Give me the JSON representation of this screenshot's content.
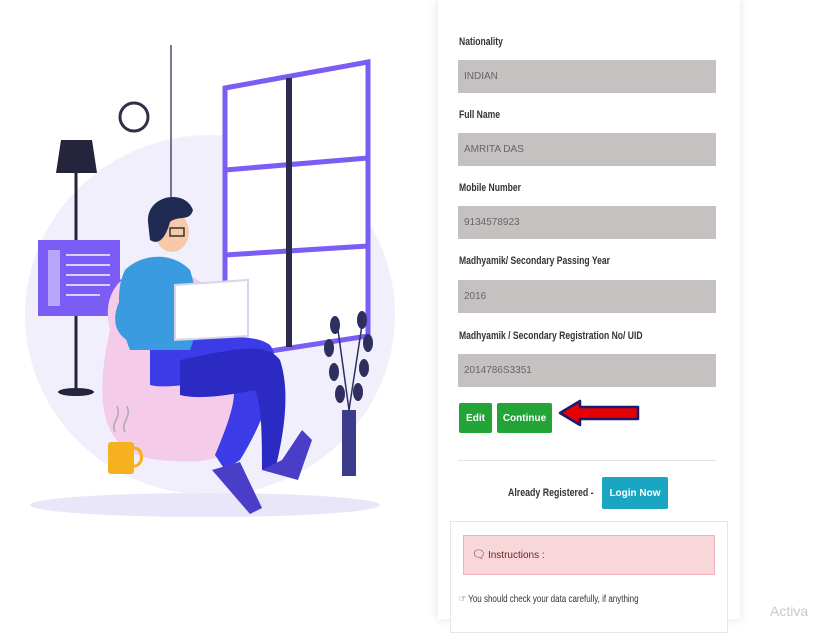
{
  "form": {
    "fields": [
      {
        "label": "Nationality",
        "value": "INDIAN"
      },
      {
        "label": "Full Name",
        "value": "AMRITA DAS"
      },
      {
        "label": "Mobile Number",
        "value": "9134578923"
      },
      {
        "label": "Madhyamik/ Secondary Passing Year",
        "value": "2016"
      },
      {
        "label": "Madhyamik / Secondary Registration No/ UID",
        "value": "2014786S3351"
      }
    ],
    "edit_label": "Edit",
    "continue_label": "Continue",
    "already_registered_text": "Already Registered -",
    "login_now_label": "Login Now"
  },
  "instructions": {
    "heading": "Instructions :",
    "text": "You should check your data carefully, if anything"
  },
  "overlay": {
    "activate_text": "Activa"
  },
  "colors": {
    "success": "#23a437",
    "info": "#1aa6c2",
    "annotation_arrow": "#e60000"
  }
}
